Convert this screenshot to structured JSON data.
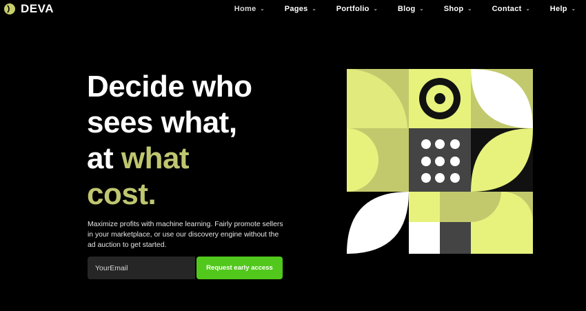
{
  "brand": {
    "name": "DEVA"
  },
  "nav": [
    {
      "label": "Home",
      "active": true
    },
    {
      "label": "Pages"
    },
    {
      "label": "Portfolio"
    },
    {
      "label": "Blog"
    },
    {
      "label": "Shop"
    },
    {
      "label": "Contact"
    },
    {
      "label": "Help"
    }
  ],
  "hero": {
    "line1": "Decide who",
    "line2": "sees what,",
    "line3_a": "at ",
    "line3_b": "what",
    "line4": "cost.",
    "description": "Maximize profits with machine learning. Fairly promote sellers in your marketplace, or use our discovery engine without the ad auction to get started."
  },
  "form": {
    "email_placeholder": "YourEmail",
    "cta_label": "Request early access"
  },
  "colors": {
    "background": "#000000",
    "accent_text": "#bfc670",
    "cta": "#52c71c",
    "lime": "#e6f27c",
    "olive": "#c2c96d"
  }
}
